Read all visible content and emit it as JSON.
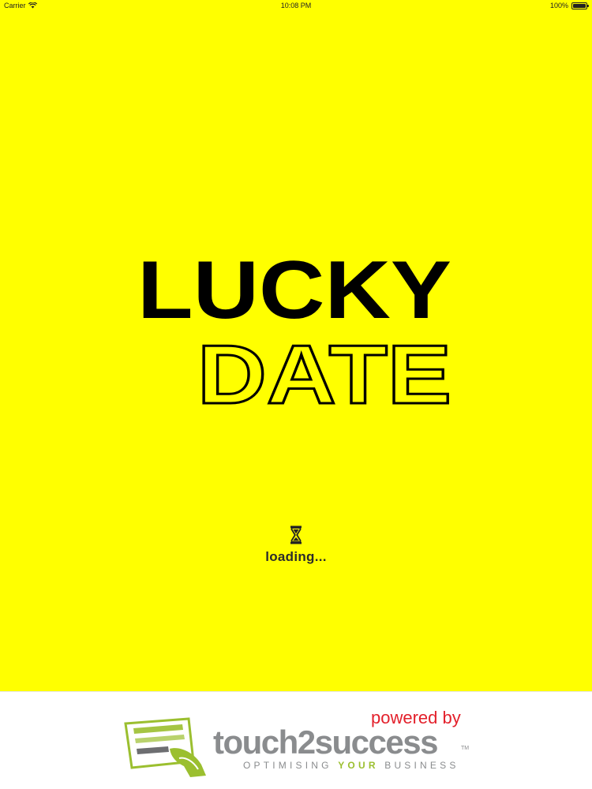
{
  "status_bar": {
    "carrier": "Carrier",
    "time": "10:08 PM",
    "battery": "100%",
    "battery_level": 1.0
  },
  "splash": {
    "background_color": "#ffff00",
    "logo_line1": "LUCKY",
    "logo_line2": "DATE",
    "loading_text": "loading..."
  },
  "footer": {
    "powered_by": "powered by",
    "brand_name": "touch2success",
    "trademark": "TM",
    "tagline_pre": "OPTIMISING ",
    "tagline_highlight": "YOUR",
    "tagline_post": " BUSINESS",
    "brand_red": "#e3202b",
    "brand_grey": "#8a8c8e",
    "brand_green": "#9bbf2f"
  }
}
